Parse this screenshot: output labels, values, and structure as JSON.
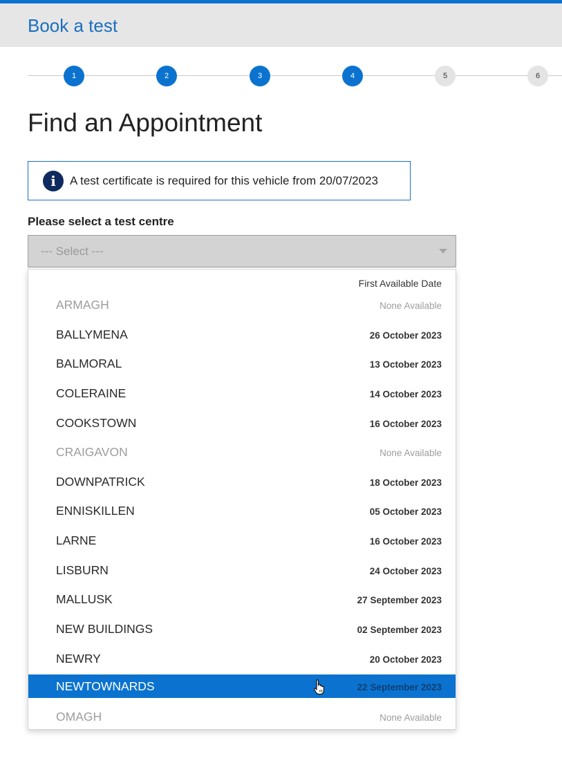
{
  "header": {
    "title": "Book a test"
  },
  "stepper": {
    "steps": [
      {
        "label": "1",
        "state": "done"
      },
      {
        "label": "2",
        "state": "done"
      },
      {
        "label": "3",
        "state": "done"
      },
      {
        "label": "4",
        "state": "done"
      },
      {
        "label": "5",
        "state": "todo"
      },
      {
        "label": "6",
        "state": "todo"
      }
    ]
  },
  "page": {
    "title": "Find an Appointment"
  },
  "info": {
    "icon": "info-icon",
    "glyph": "i",
    "text": "A test certificate is required for this vehicle from 20/07/2023"
  },
  "centre_select": {
    "label": "Please select a test centre",
    "selected": "--- Select ---",
    "column_header": "First Available Date",
    "options": [
      {
        "name": "ARMAGH",
        "date": "None Available",
        "available": false
      },
      {
        "name": "BALLYMENA",
        "date": "26 October 2023",
        "available": true
      },
      {
        "name": "BALMORAL",
        "date": "13 October 2023",
        "available": true
      },
      {
        "name": "COLERAINE",
        "date": "14 October 2023",
        "available": true
      },
      {
        "name": "COOKSTOWN",
        "date": "16 October 2023",
        "available": true
      },
      {
        "name": "CRAIGAVON",
        "date": "None Available",
        "available": false
      },
      {
        "name": "DOWNPATRICK",
        "date": "18 October 2023",
        "available": true
      },
      {
        "name": "ENNISKILLEN",
        "date": "05 October 2023",
        "available": true
      },
      {
        "name": "LARNE",
        "date": "16 October 2023",
        "available": true
      },
      {
        "name": "LISBURN",
        "date": "24 October 2023",
        "available": true
      },
      {
        "name": "MALLUSK",
        "date": "27 September 2023",
        "available": true
      },
      {
        "name": "NEW BUILDINGS",
        "date": "02 September 2023",
        "available": true
      },
      {
        "name": "NEWRY",
        "date": "20 October 2023",
        "available": true
      },
      {
        "name": "NEWTOWNARDS",
        "date": "22 September 2023",
        "available": true,
        "highlighted": true
      },
      {
        "name": "OMAGH",
        "date": "None Available",
        "available": false
      }
    ]
  },
  "colors": {
    "accent": "#0b73cf",
    "header_bg": "#e6e6e6",
    "info_icon_bg": "#0f2a5e"
  }
}
